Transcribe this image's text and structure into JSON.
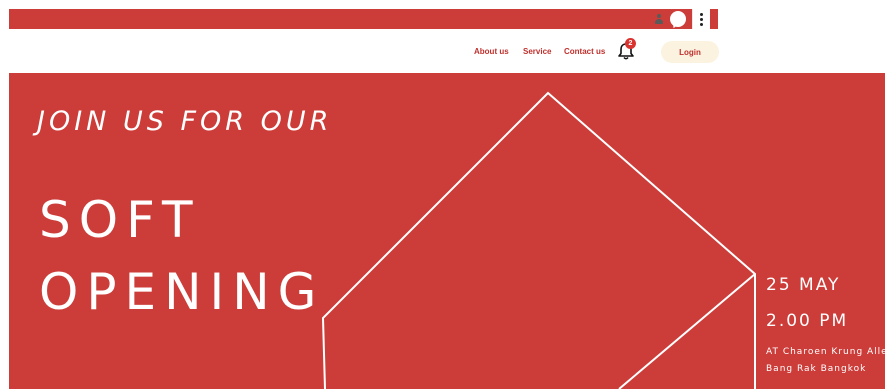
{
  "nav": {
    "links": [
      "About us",
      "Service",
      "Contact us"
    ],
    "notification_count": "2",
    "login_label": "Login"
  },
  "hero": {
    "kicker": "JOIN US FOR OUR",
    "title_line1": "SOFT",
    "title_line2": "OPENING",
    "date": "25 MAY",
    "time": "2.00 PM",
    "address_line1": "AT Charoen Krung Alley",
    "address_line2": "Bang Rak Bangkok"
  },
  "colors": {
    "brand_red": "#cc3c39",
    "login_bg": "#fbf3df",
    "link_red": "#c0302d"
  },
  "icons": [
    "user-icon",
    "chat-icon",
    "kebab-menu-icon",
    "bell-icon"
  ]
}
